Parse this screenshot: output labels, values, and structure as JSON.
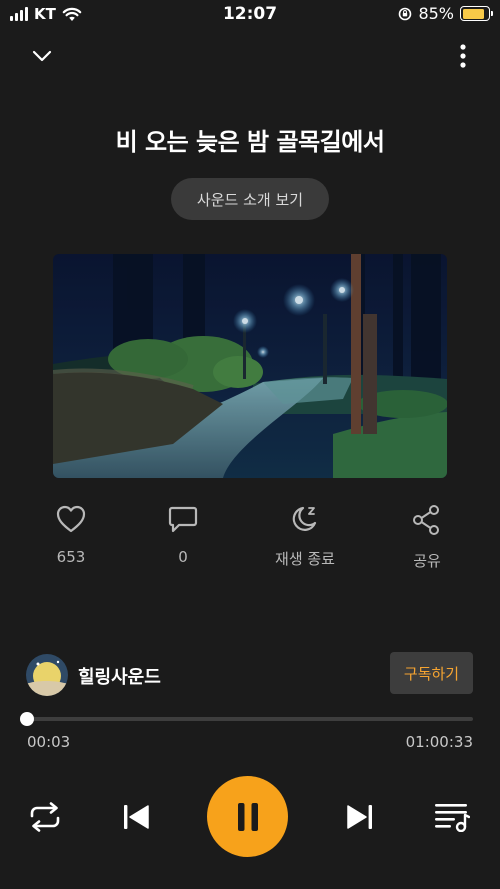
{
  "status_bar": {
    "carrier": "KT",
    "time": "12:07",
    "battery_percent": "85%",
    "battery_level": 0.85
  },
  "icons": {
    "collapse": "chevron-down-icon",
    "more": "more-vertical-icon",
    "like": "heart-icon",
    "comment": "comment-icon",
    "sleep_timer": "moon-icon",
    "share": "share-icon",
    "repeat": "repeat-icon",
    "previous": "skip-previous-icon",
    "pause": "pause-icon",
    "next": "skip-next-icon",
    "playlist": "playlist-icon"
  },
  "track": {
    "title": "비 오는 늦은 밤 골목길에서",
    "intro_button": "사운드 소개 보기"
  },
  "actions": {
    "likes": "653",
    "comments": "0",
    "sleep_timer": "재생 종료",
    "share": "공유"
  },
  "channel": {
    "name": "힐링사운드",
    "subscribe_label": "구독하기"
  },
  "playback": {
    "current_time": "00:03",
    "total_time": "01:00:33",
    "progress": 0.0008
  },
  "colors": {
    "background": "#1b1b1b",
    "accent": "#f7a21b",
    "subscribe_text": "#f5a431"
  }
}
